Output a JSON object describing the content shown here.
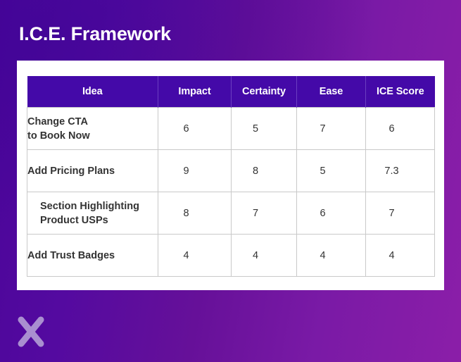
{
  "slide": {
    "title": "I.C.E. Framework",
    "background_gradient_from": "#4b0599",
    "background_gradient_to": "#8b1ea8",
    "card_background": "#ffffff"
  },
  "logo": {
    "name": "x-mark-logo",
    "color": "#a98fd0"
  },
  "table": {
    "header_background": "#4409a8",
    "header_text_color": "#ffffff",
    "body_text_color": "#333333",
    "border_color": "#c9c9c9",
    "columns": [
      {
        "key": "idea",
        "label": "Idea"
      },
      {
        "key": "impact",
        "label": "Impact"
      },
      {
        "key": "certainty",
        "label": "Certainty"
      },
      {
        "key": "ease",
        "label": "Ease"
      },
      {
        "key": "ice_score",
        "label": "ICE Score"
      }
    ],
    "rows": [
      {
        "idea_line1": "Change CTA",
        "idea_line2": "to Book Now",
        "impact": "6",
        "certainty": "5",
        "ease": "7",
        "ice_score": "6"
      },
      {
        "idea_line1": "Add Pricing Plans",
        "idea_line2": "",
        "impact": "9",
        "certainty": "8",
        "ease": "5",
        "ice_score": "7.3"
      },
      {
        "idea_line1": "Section Highlighting",
        "idea_line2": "Product USPs",
        "impact": "8",
        "certainty": "7",
        "ease": "6",
        "ice_score": "7"
      },
      {
        "idea_line1": "Add Trust Badges",
        "idea_line2": "",
        "impact": "4",
        "certainty": "4",
        "ease": "4",
        "ice_score": "4"
      }
    ]
  }
}
